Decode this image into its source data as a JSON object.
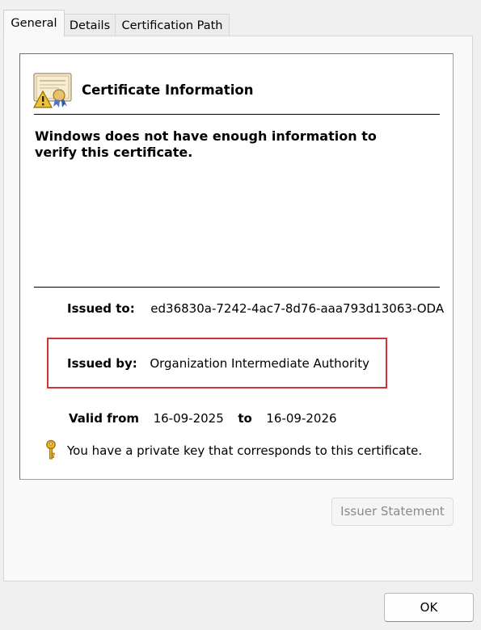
{
  "tabs": [
    {
      "label": "General",
      "active": true
    },
    {
      "label": "Details",
      "active": false
    },
    {
      "label": "Certification Path",
      "active": false
    }
  ],
  "cert": {
    "heading": "Certificate Information",
    "warning": "Windows does not have enough information to verify this certificate.",
    "issued_to_label": "Issued to:",
    "issued_to_value": "ed36830a-7242-4ac7-8d76-aaa793d13063-ODA",
    "issued_by_label": "Issued by:",
    "issued_by_value": "Organization Intermediate Authority",
    "valid_from_label": "Valid from",
    "valid_from_value": "16-09-2025",
    "valid_to_label": "to",
    "valid_to_value": "16-09-2026",
    "private_key_text": "You have a private key that corresponds to this certificate."
  },
  "buttons": {
    "issuer_statement": "Issuer Statement",
    "ok": "OK"
  },
  "icons": {
    "certificate": "certificate-warning-icon",
    "key": "key-icon"
  },
  "colors": {
    "highlight_box": "#d13438"
  }
}
